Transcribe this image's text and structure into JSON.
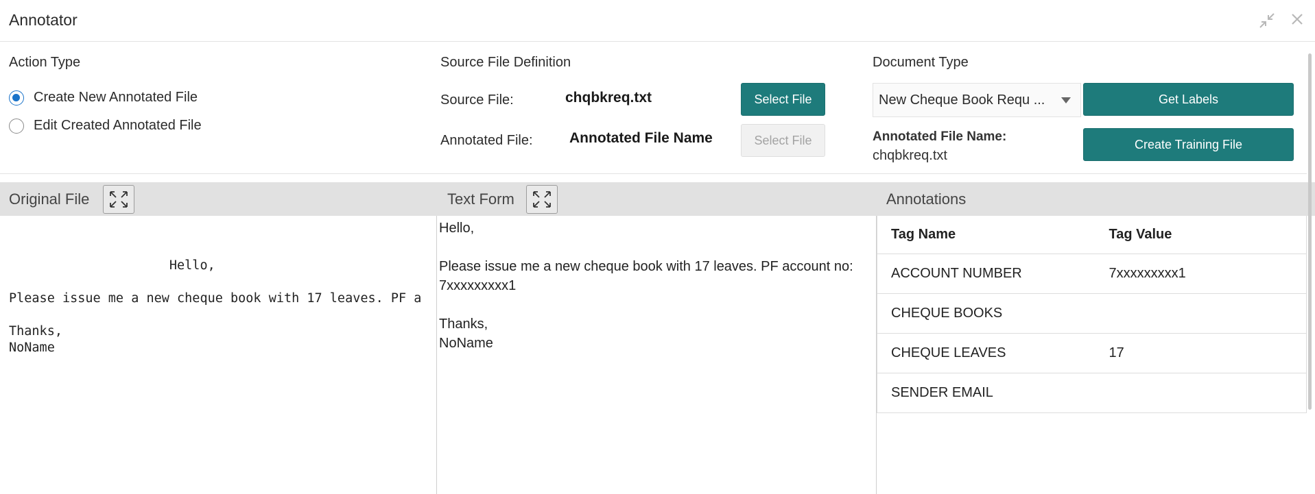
{
  "window": {
    "title": "Annotator",
    "minimize_icon": "shrink-arrows-icon",
    "close_icon": "close-icon"
  },
  "action_type": {
    "title": "Action Type",
    "options": [
      {
        "label": "Create New Annotated File",
        "checked": true
      },
      {
        "label": "Edit Created Annotated File",
        "checked": false
      }
    ]
  },
  "source_def": {
    "title": "Source File Definition",
    "source_label": "Source File:",
    "source_value": "chqbkreq.txt",
    "source_button": "Select File",
    "annotated_label": "Annotated File:",
    "annotated_value": "Annotated File Name",
    "annotated_button": "Select File"
  },
  "document_type": {
    "title": "Document Type",
    "selected": "New Cheque Book Requ ...",
    "get_labels_button": "Get Labels",
    "annotated_name_label": "Annotated File Name:",
    "annotated_name_value": "chqbkreq.txt",
    "create_training_button": "Create Training File"
  },
  "panels": {
    "original_title": "Original File",
    "text_form_title": "Text Form",
    "annotations_title": "Annotations",
    "expand_icon": "expand-icon"
  },
  "original_file": {
    "content": "                     Hello,\n\nPlease issue me a new cheque book with 17 leaves. PF a\n\nThanks,\nNoName"
  },
  "text_form": {
    "line1": "Hello,",
    "line2": "Please issue me a new cheque book with 17 leaves. PF account no:",
    "line3": "7xxxxxxxxx1",
    "line4": "Thanks,",
    "line5": "NoName"
  },
  "annotations": {
    "headers": [
      "Tag Name",
      "Tag Value"
    ],
    "rows": [
      {
        "name": "ACCOUNT NUMBER",
        "value": "7xxxxxxxxx1"
      },
      {
        "name": "CHEQUE BOOKS",
        "value": ""
      },
      {
        "name": "CHEQUE LEAVES",
        "value": "17"
      },
      {
        "name": "SENDER EMAIL",
        "value": ""
      }
    ]
  },
  "colors": {
    "accent": "#1e7b7b",
    "radio": "#1a73c9",
    "panel_bar": "#e1e1e1"
  }
}
